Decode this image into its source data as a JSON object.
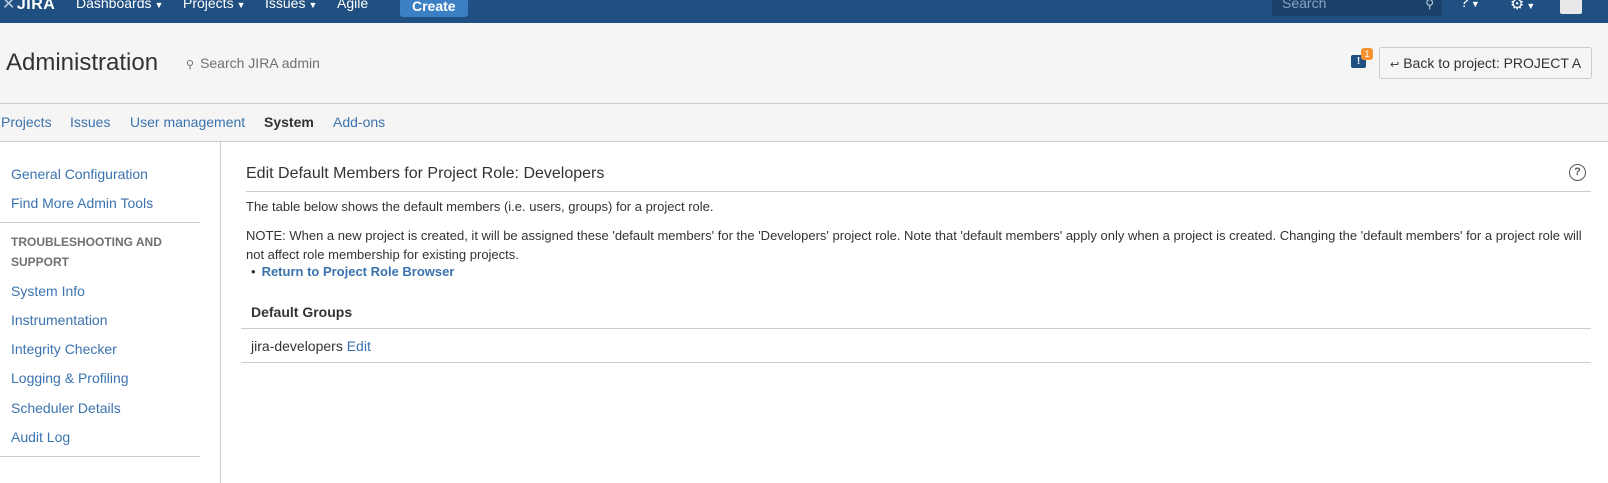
{
  "topnav": {
    "logo": "JIRA",
    "logo_mark": "✕",
    "menus": [
      {
        "label": "Dashboards"
      },
      {
        "label": "Projects"
      },
      {
        "label": "Issues"
      },
      {
        "label": "Agile"
      }
    ],
    "create_label": "Create",
    "search_placeholder": "Search"
  },
  "admin": {
    "title": "Administration",
    "search_placeholder": "Search JIRA admin",
    "notification_count": "1",
    "back_label": "Back to project: PROJECT A"
  },
  "tabs": [
    {
      "label": "Projects",
      "active": false
    },
    {
      "label": "Issues",
      "active": false
    },
    {
      "label": "User management",
      "active": false
    },
    {
      "label": "System",
      "active": true
    },
    {
      "label": "Add-ons",
      "active": false
    }
  ],
  "sidebar": {
    "top_links": [
      {
        "label": "General Configuration"
      },
      {
        "label": "Find More Admin Tools"
      }
    ],
    "section_heading": "TROUBLESHOOTING AND SUPPORT",
    "section_links": [
      {
        "label": "System Info"
      },
      {
        "label": "Instrumentation"
      },
      {
        "label": "Integrity Checker"
      },
      {
        "label": "Logging & Profiling"
      },
      {
        "label": "Scheduler Details"
      },
      {
        "label": "Audit Log"
      }
    ]
  },
  "main": {
    "heading": "Edit Default Members for Project Role: Developers",
    "description": "The table below shows the default members (i.e. users, groups) for a project role.",
    "note": "NOTE: When a new project is created, it will be assigned these 'default members' for the 'Developers' project role. Note that 'default members' apply only when a project is created. Changing the 'default members' for a project role will not affect role membership for existing projects.",
    "return_link": "Return to Project Role Browser",
    "groups_header": "Default Groups",
    "group_name": "jira-developers",
    "edit_label": "Edit"
  },
  "colors": {
    "topnav_bg": "#205081",
    "link": "#3b73af",
    "create_btn": "#3b7fc4",
    "badge": "#f79232"
  }
}
